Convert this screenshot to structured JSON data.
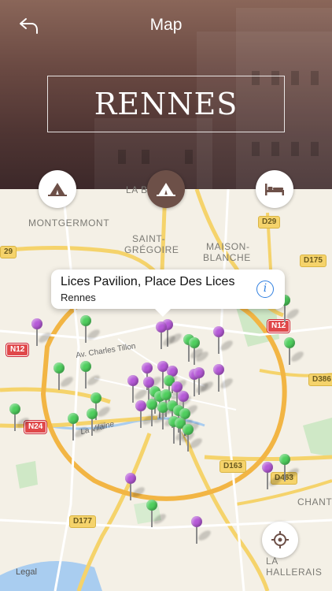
{
  "header": {
    "title": "Map",
    "city": "RENNES"
  },
  "tabs": [
    {
      "name": "attractions",
      "icon": "tent-icon",
      "active": false
    },
    {
      "name": "places",
      "icon": "tent-active-icon",
      "active": true
    },
    {
      "name": "hotels",
      "icon": "bed-icon",
      "active": false
    }
  ],
  "map": {
    "places": {
      "montgermont": "MONTGERMONT",
      "saint_gregoire_1": "SAINT-",
      "saint_gregoire_2": "GRÉGOIRE",
      "maison_blanche_1": "MAISON-",
      "maison_blanche_2": "BLANCHE",
      "la_be": "LA BE",
      "chante": "CHANTE",
      "la_hallerais": "LA HALLERAIS"
    },
    "roads": {
      "d29": "D29",
      "d175": "D175",
      "n12_right": "N12",
      "n12_left": "N12",
      "d386": "D386",
      "n24": "N24",
      "d163": "D163",
      "d463": "D463",
      "d177": "D177",
      "rte29": "29",
      "av_charles_tillon": "Av. Charles Tillon",
      "la_vilaine": "La Vilaine"
    },
    "legal": "Legal",
    "callout": {
      "title": "Lices Pavilion, Place Des Lices",
      "subtitle": "Rennes"
    }
  },
  "colors": {
    "purple_pin": "#b65ad8",
    "green_pin": "#4fcf5e",
    "info_blue": "#2f7fe0",
    "header_brown": "#6d5048"
  }
}
